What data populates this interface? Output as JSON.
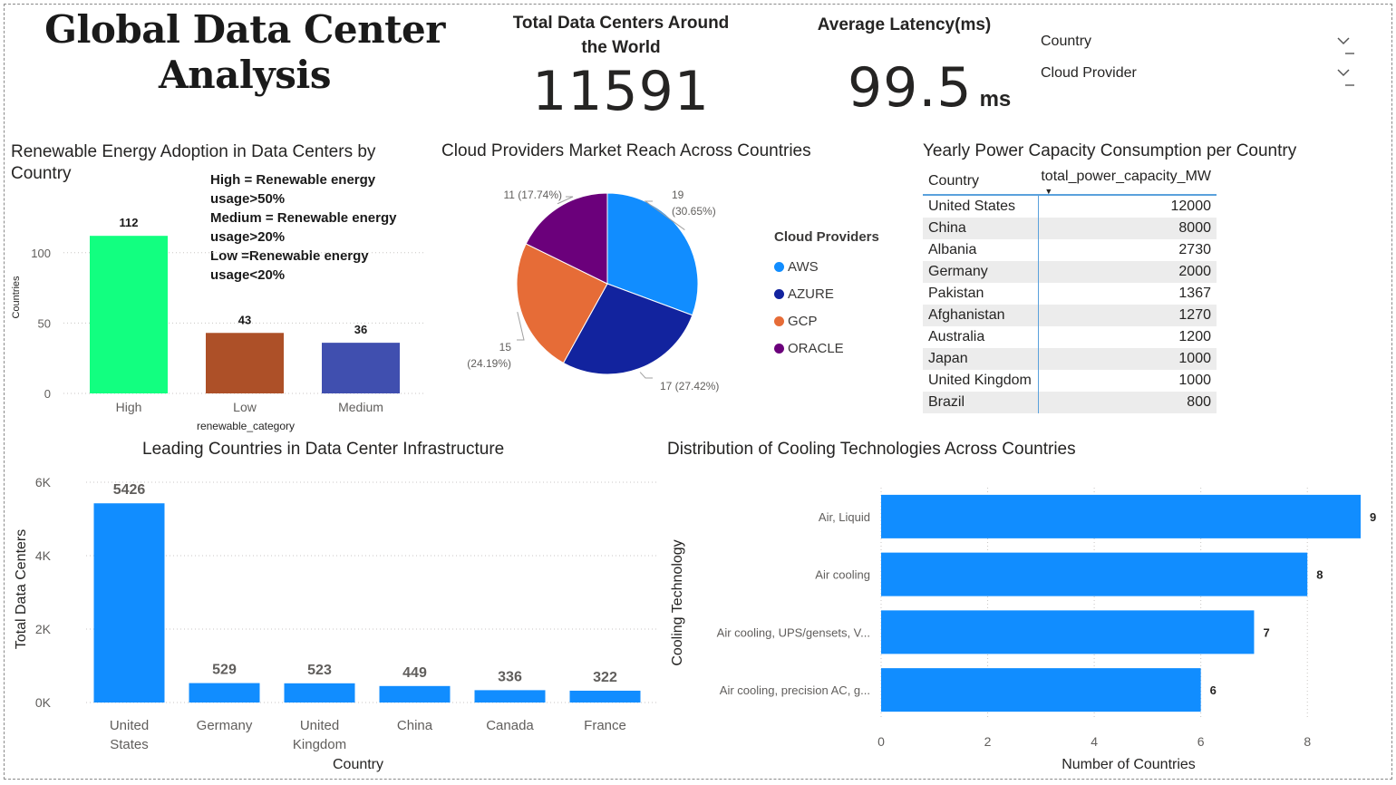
{
  "title": "Global Data Center Analysis",
  "kpis": {
    "total_label": "Total Data Centers Around the World",
    "total_value": "11591",
    "latency_label": "Average Latency(ms)",
    "latency_value": "99.5",
    "latency_unit": "ms"
  },
  "slicers": [
    {
      "label": "Country"
    },
    {
      "label": "Cloud Provider"
    }
  ],
  "colors": {
    "accent_blue": "#118dff",
    "green": "#12ff80",
    "brown": "#ad5028",
    "indigo": "#404faf",
    "azure": "#12239e",
    "gcp": "#e66c37",
    "oracle": "#6b007b"
  },
  "chart_data": [
    {
      "id": "renewable",
      "type": "bar",
      "title": "Renewable Energy Adoption in Data Centers by Country",
      "xlabel": "renewable_category",
      "ylabel": "Countries",
      "categories": [
        "High",
        "Low",
        "Medium"
      ],
      "values": [
        112,
        43,
        36
      ],
      "ylim": [
        0,
        125
      ],
      "yticks": [
        0,
        50,
        100
      ],
      "grid": true,
      "annotation": [
        "High = Renewable energy usage>50%",
        "Medium = Renewable energy usage>20%",
        "Low =Renewable energy usage<20%"
      ]
    },
    {
      "id": "providers",
      "type": "pie",
      "title": "Cloud Providers Market Reach Across Countries",
      "legend_title": "Cloud Providers",
      "legend_position": "right",
      "categories": [
        "AWS",
        "AZURE",
        "GCP",
        "ORACLE"
      ],
      "values": [
        19,
        17,
        15,
        11
      ],
      "percent_labels": [
        "(30.65%)",
        "(27.42%)",
        "(24.19%)",
        "(17.74%)"
      ]
    },
    {
      "id": "power",
      "type": "table",
      "title": "Yearly Power Capacity Consumption per Country",
      "columns": [
        "Country",
        "total_power_capacity_MW"
      ],
      "rows": [
        [
          "United States",
          "12000"
        ],
        [
          "China",
          "8000"
        ],
        [
          "Albania",
          "2730"
        ],
        [
          "Germany",
          "2000"
        ],
        [
          "Pakistan",
          "1367"
        ],
        [
          "Afghanistan",
          "1270"
        ],
        [
          "Australia",
          "1200"
        ],
        [
          "Japan",
          "1000"
        ],
        [
          "United Kingdom",
          "1000"
        ],
        [
          "Brazil",
          "800"
        ]
      ]
    },
    {
      "id": "leading",
      "type": "bar",
      "title": "Leading Countries in Data Center Infrastructure",
      "xlabel": "Country",
      "ylabel": "Total Data Centers",
      "categories": [
        [
          "United",
          "States"
        ],
        [
          "Germany"
        ],
        [
          "United",
          "Kingdom"
        ],
        [
          "China"
        ],
        [
          "Canada"
        ],
        [
          "France"
        ]
      ],
      "values": [
        5426,
        529,
        523,
        449,
        336,
        322
      ],
      "ylim": [
        0,
        6000
      ],
      "yticks": [
        0,
        2000,
        4000,
        6000
      ],
      "ytick_labels": [
        "0K",
        "2K",
        "4K",
        "6K"
      ],
      "grid": true
    },
    {
      "id": "cooling",
      "type": "bar",
      "orientation": "horizontal",
      "title": "Distribution of Cooling Technologies Across Countries",
      "xlabel": "Number of Countries",
      "ylabel": "Cooling Technology",
      "categories": [
        "Air, Liquid",
        "Air cooling",
        "Air cooling, UPS/gensets, V...",
        "Air cooling, precision AC, g..."
      ],
      "values": [
        9,
        8,
        7,
        6
      ],
      "xlim": [
        0,
        9
      ],
      "xticks": [
        0,
        2,
        4,
        6,
        8
      ],
      "grid": true
    }
  ]
}
